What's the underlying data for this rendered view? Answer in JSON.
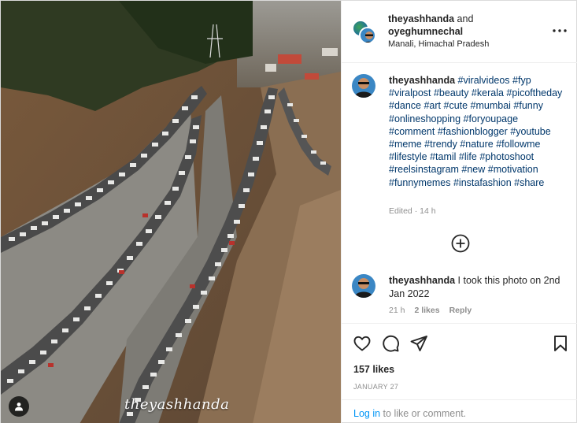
{
  "post": {
    "watermark": "theyashhanda",
    "author": {
      "username": "theyashhanda",
      "connector": "and",
      "coauthor": "oyeghumnechal",
      "location": "Manali, Himachal Pradesh"
    },
    "caption": {
      "username": "theyashhanda",
      "text": "#viralvideos #fyp #viralpost #beauty #kerala #picoftheday #dance #art #cute #mumbai #funny #onlineshopping #foryoupage #comment #fashionblogger #youtube #meme #trendy #nature #followme #lifestyle #tamil #life #photoshoot #reelsinstagram #new #motivation #funnymemes #instafashion #share",
      "meta": "Edited · 14 h"
    },
    "comment": {
      "username": "theyashhanda",
      "text": "I took this photo on 2nd Jan 2022",
      "time": "21 h",
      "likes": "2 likes",
      "reply": "Reply"
    },
    "likes": "157 likes",
    "date": "JANUARY 27",
    "login": {
      "link": "Log in",
      "rest": "to like or comment."
    }
  },
  "icons": {
    "more": "more-options-icon",
    "load_more": "plus-circle-icon",
    "like": "heart-icon",
    "comment": "comment-icon",
    "share": "send-icon",
    "save": "bookmark-icon",
    "tagged": "user-tag-icon"
  },
  "colors": {
    "hashtag": "#00376b",
    "link": "#0095f6",
    "muted": "#8e8e8e",
    "text": "#262626"
  }
}
